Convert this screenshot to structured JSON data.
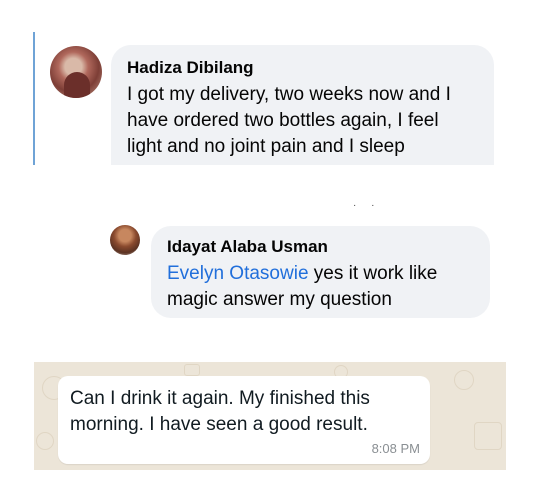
{
  "comment1": {
    "author": "Hadiza Dibilang",
    "text": "I got my delivery, two weeks now and I have ordered two bottles again, I feel light and no joint pain and I sleep"
  },
  "separator_dots": "· ·",
  "comment2": {
    "author": "Idayat Alaba Usman",
    "mention": "Evelyn Otasowie",
    "text": " yes it work like magic  answer my question"
  },
  "whatsapp": {
    "message": "Can I drink it again. My finished this morning. I have seen a good result.",
    "time": "8:08 PM"
  }
}
